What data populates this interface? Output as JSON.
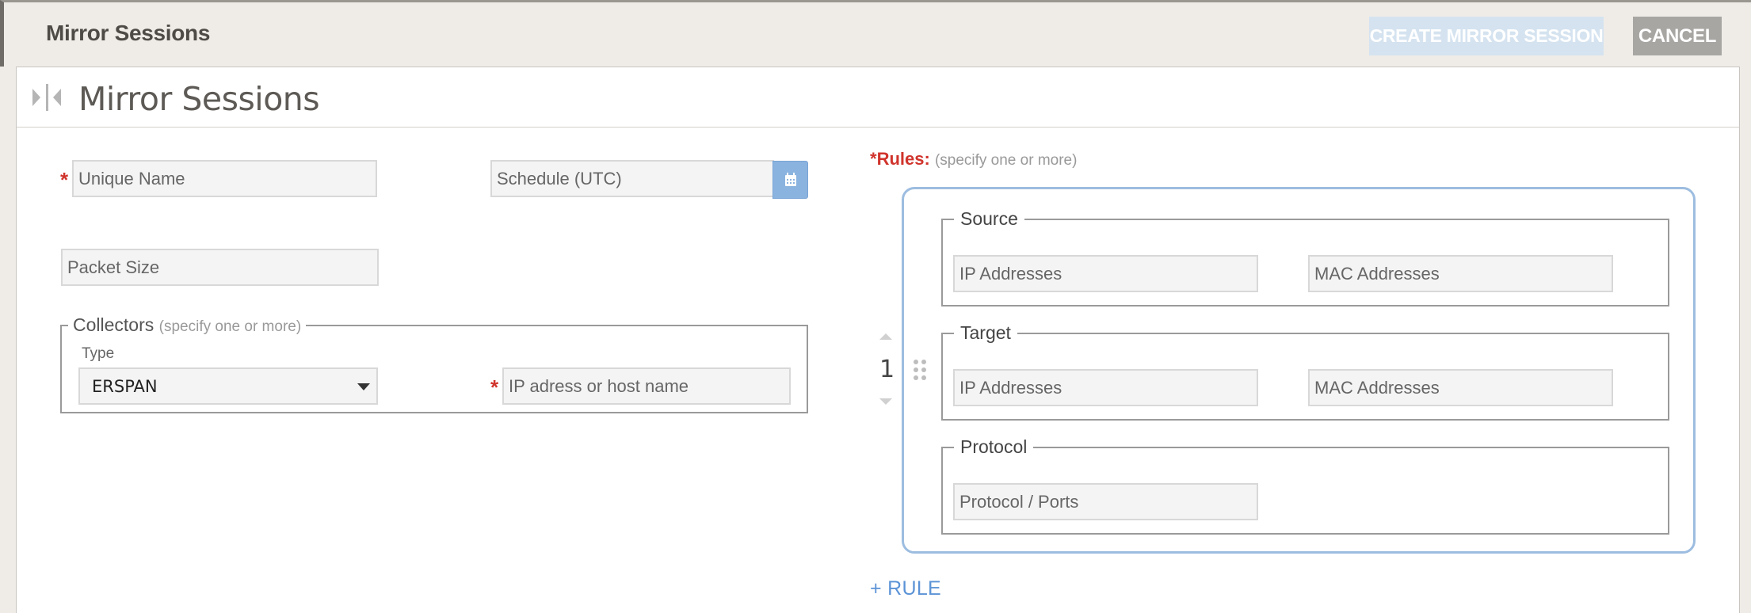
{
  "topbar": {
    "title": "Mirror Sessions",
    "create_label": "CREATE MIRROR SESSION",
    "cancel_label": "CANCEL"
  },
  "panel": {
    "title": "Mirror Sessions"
  },
  "form": {
    "required_mark": "*",
    "unique_name_placeholder": "Unique Name",
    "schedule_placeholder": "Schedule (UTC)",
    "packet_size_placeholder": "Packet Size",
    "collectors": {
      "legend": "Collectors",
      "hint": "(specify one or more)",
      "type_label": "Type",
      "type_value": "ERSPAN",
      "destination_placeholder": "IP adress or host name"
    }
  },
  "rules": {
    "label": "Rules:",
    "hint": "(specify one or more)",
    "items": [
      {
        "number": "1",
        "source": {
          "legend": "Source",
          "ip_placeholder": "IP Addresses",
          "mac_placeholder": "MAC Addresses"
        },
        "target": {
          "legend": "Target",
          "ip_placeholder": "IP Addresses",
          "mac_placeholder": "MAC Addresses"
        },
        "protocol": {
          "legend": "Protocol",
          "ports_placeholder": "Protocol / Ports"
        }
      }
    ],
    "add_label": "+ RULE"
  },
  "colors": {
    "required": "#d0342c",
    "accent": "#5b93d6",
    "create_button_disabled": "#d5e3f0",
    "cancel_button": "#a8a6a3",
    "rule_card_border": "#9dbde0"
  },
  "icons": [
    "collapse-panel-icon",
    "calendar-icon",
    "caret-down-icon",
    "arrow-up-icon",
    "arrow-down-icon",
    "drag-handle-icon"
  ]
}
